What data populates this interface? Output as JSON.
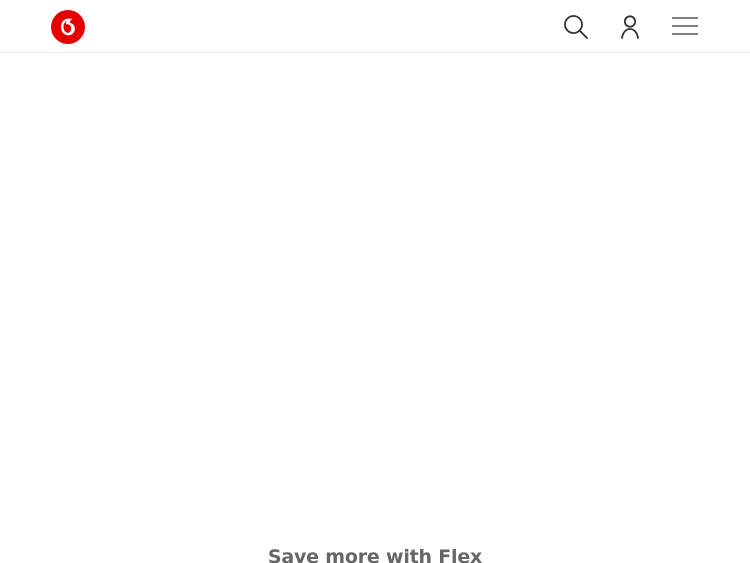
{
  "header": {
    "logo_icon": "vodafone-speechmark-logo",
    "actions": [
      {
        "name": "search",
        "icon": "search-icon"
      },
      {
        "name": "account",
        "icon": "user-icon"
      },
      {
        "name": "menu",
        "icon": "hamburger-menu-icon"
      }
    ]
  },
  "promo": {
    "title": "Save more with Flex"
  },
  "colors": {
    "brand_red": "#e60000",
    "icon_gray": "#333333",
    "text_gray": "#666666",
    "background": "#ffffff"
  }
}
